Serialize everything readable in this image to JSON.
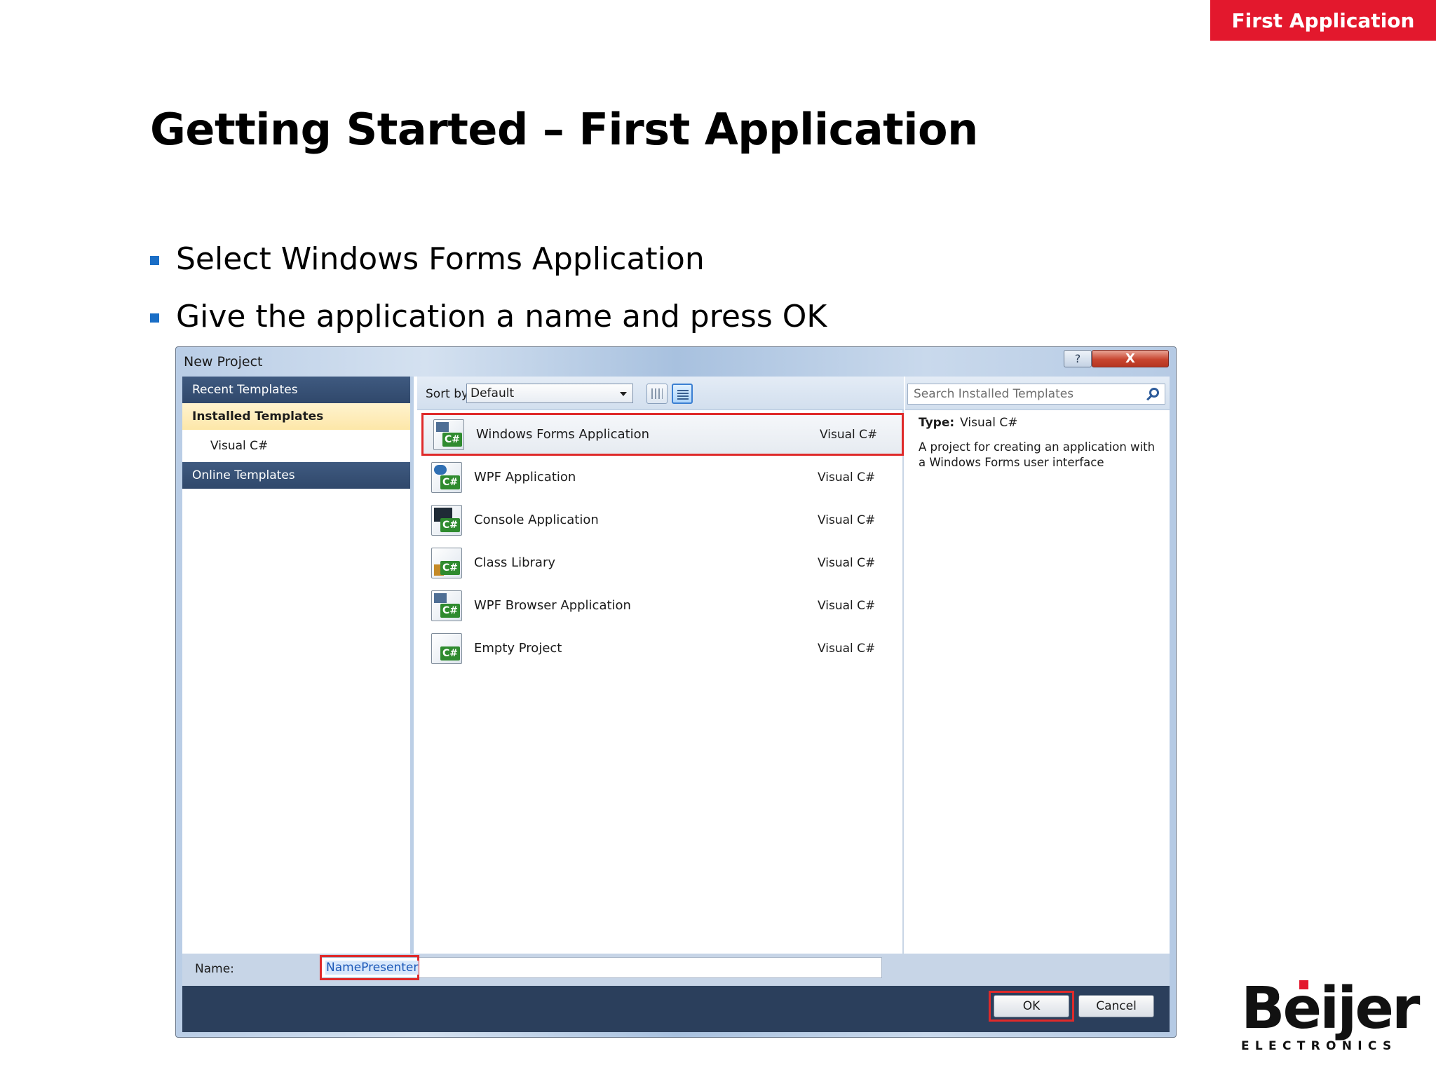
{
  "header": {
    "section_tab": "First Application"
  },
  "slide": {
    "title": "Getting Started – First Application",
    "bullets": [
      "Select Windows Forms Application",
      "Give the application a name and press OK"
    ]
  },
  "dialog": {
    "title": "New Project",
    "help_label": "?",
    "close_label": "X",
    "nav": {
      "recent": "Recent Templates",
      "installed": "Installed Templates",
      "visual_cs": "Visual C#",
      "online": "Online Templates"
    },
    "sort": {
      "label": "Sort by:",
      "value": "Default"
    },
    "search": {
      "placeholder": "Search Installed Templates"
    },
    "templates": [
      {
        "name": "Windows Forms Application",
        "lang": "Visual C#",
        "icon": "winforms-icon",
        "selected": true
      },
      {
        "name": "WPF Application",
        "lang": "Visual C#",
        "icon": "wpf-icon"
      },
      {
        "name": "Console Application",
        "lang": "Visual C#",
        "icon": "console-icon"
      },
      {
        "name": "Class Library",
        "lang": "Visual C#",
        "icon": "class-library-icon"
      },
      {
        "name": "WPF Browser Application",
        "lang": "Visual C#",
        "icon": "wpf-browser-icon"
      },
      {
        "name": "Empty Project",
        "lang": "Visual C#",
        "icon": "empty-project-icon"
      }
    ],
    "details": {
      "type_label": "Type:",
      "type_value": "Visual C#",
      "description": "A project for creating an application with a Windows Forms user interface"
    },
    "name_field": {
      "label": "Name:",
      "value": "NamePresenter"
    },
    "buttons": {
      "ok": "OK",
      "cancel": "Cancel"
    },
    "icon_badge": "C#"
  },
  "logo": {
    "word": "Beijer",
    "sub": "ELECTRONICS"
  },
  "colors": {
    "accent_red": "#e3182d",
    "bullet_blue": "#1a6ec6",
    "highlight_red": "#df2a2a"
  }
}
